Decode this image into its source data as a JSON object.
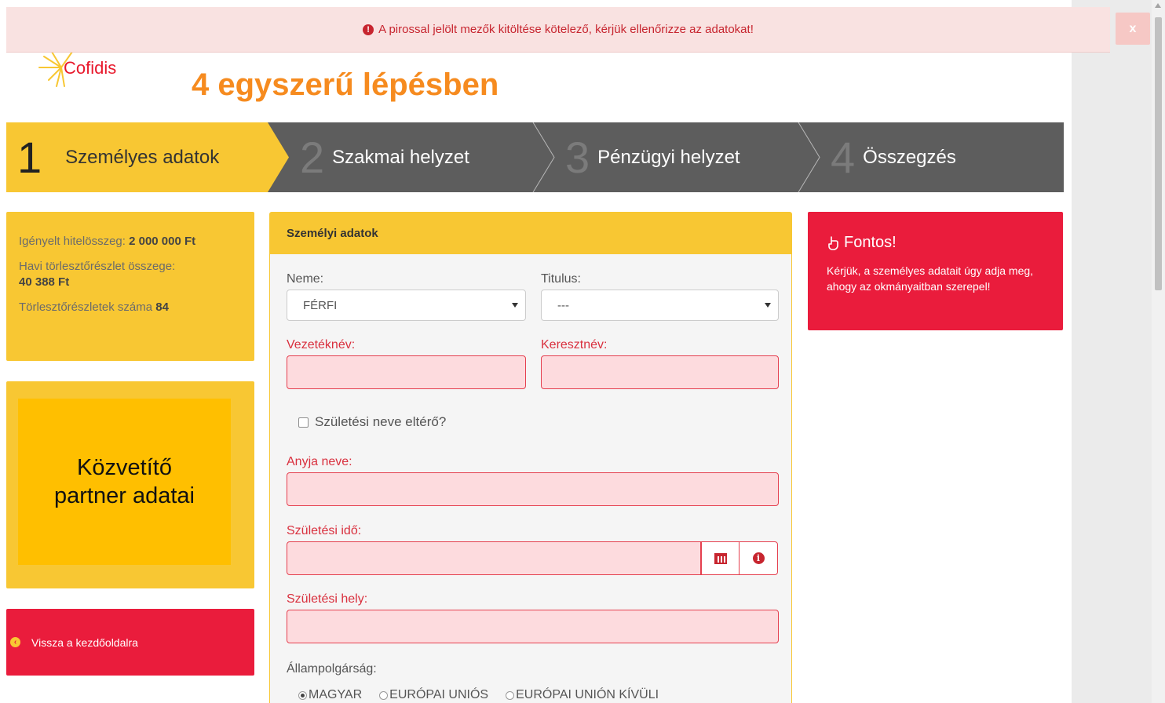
{
  "alert": {
    "message": "A pirossal jelölt mezők kitöltése kötelező, kérjük ellenőrizze az adatokat!",
    "close_label": "x",
    "icon": "exclamation-circle-icon"
  },
  "logo": {
    "text": "Cofidis"
  },
  "page": {
    "title": "4 egyszerű lépésben"
  },
  "steps": [
    {
      "number": "1",
      "label": "Személyes adatok",
      "active": true
    },
    {
      "number": "2",
      "label": "Szakmai helyzet",
      "active": false
    },
    {
      "number": "3",
      "label": "Pénzügyi helyzet",
      "active": false
    },
    {
      "number": "4",
      "label": "Összegzés",
      "active": false
    }
  ],
  "loan": {
    "amount_label": "Igényelt hitelösszeg:",
    "amount_value": "2 000 000 Ft",
    "installment_label": "Havi törlesztőrészlet összege:",
    "installment_value": "40 388 Ft",
    "count_label": "Törlesztőrészletek száma",
    "count_value": "84"
  },
  "partner": {
    "line1": "Közvetítő",
    "line2": "partner adatai"
  },
  "back": {
    "label": "Vissza a kezdőoldalra"
  },
  "form": {
    "header": "Személyi adatok",
    "gender_label": "Neme:",
    "gender_value": "FÉRFI",
    "title_label": "Titulus:",
    "title_value": "---",
    "lastname_label": "Vezetéknév:",
    "firstname_label": "Keresztnév:",
    "birthname_checkbox_label": "Születési neve eltérő?",
    "mother_label": "Anyja neve:",
    "birthdate_label": "Születési idő:",
    "birthplace_label": "Születési hely:",
    "citizenship_label": "Állampolgárság:",
    "citizenship_options": [
      {
        "label": "MAGYAR",
        "selected": true
      },
      {
        "label": "EURÓPAI UNIÓS",
        "selected": false
      },
      {
        "label": "EURÓPAI UNIÓN KÍVÜLI",
        "selected": false
      }
    ]
  },
  "notice": {
    "title": "Fontos!",
    "body": "Kérjük, a személyes adatait úgy adja meg, ahogy az okmányaitban szerepel!",
    "icon": "hand-pointer-icon"
  },
  "colors": {
    "brand_yellow": "#f8c733",
    "brand_red": "#ea1c3c",
    "title_orange": "#f68b1f",
    "step_gray": "#5d5d5d",
    "error_field_bg": "#fddbde"
  }
}
